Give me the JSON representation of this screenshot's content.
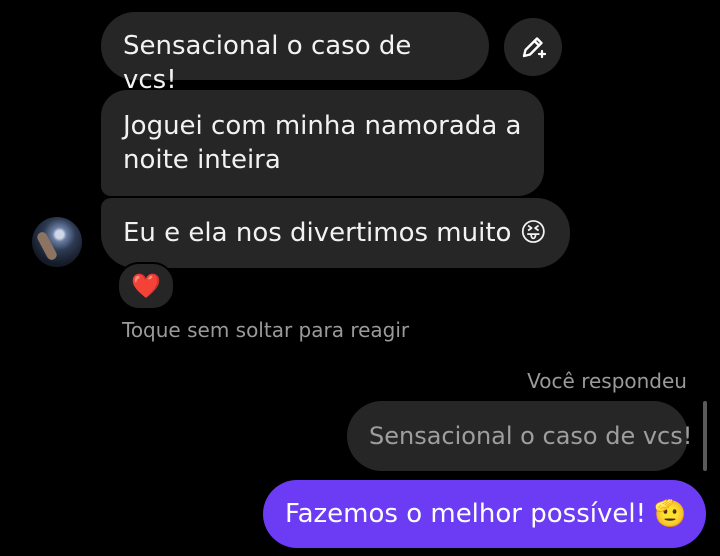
{
  "messages": [
    {
      "text": "Sensacional o caso de vcs!"
    },
    {
      "text": "Joguei com minha namorada a noite inteira"
    },
    {
      "text": "Eu e ela nos divertimos muito",
      "emoji": "😝"
    }
  ],
  "reaction": {
    "emoji": "❤️"
  },
  "hint": "Toque sem soltar para reagir",
  "reply_label": "Você respondeu",
  "quoted_message": "Sensacional o caso de vcs!",
  "my_message": {
    "text": "Fazemos o melhor possível!",
    "emoji": "🫡"
  },
  "colors": {
    "background": "#000000",
    "bubble": "#262626",
    "my_bubble": "#6c3cf5",
    "muted_text": "#9a9a9a"
  },
  "icons": {
    "edit": "edit-sparkle-icon"
  }
}
